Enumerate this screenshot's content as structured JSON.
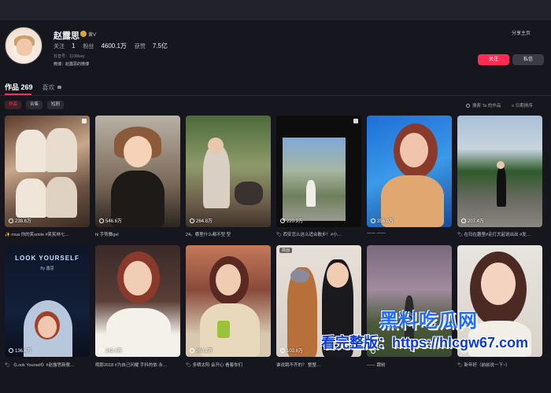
{
  "profile": {
    "name": "赵露思",
    "verified_label": "黄V",
    "stats": [
      {
        "label": "关注",
        "value": "1"
      },
      {
        "label": "粉丝",
        "value": "4600.1万"
      },
      {
        "label": "获赞",
        "value": "7.5亿"
      }
    ],
    "account": "抖音号：1108lusy",
    "bio": "微博：赵露思的微博",
    "share_label": "分享主页",
    "follow_label": "关注",
    "message_label": "私信"
  },
  "tabs": {
    "works": "作品 269",
    "likes": "喜欢"
  },
  "filters": [
    "作品",
    "合集",
    "短剧"
  ],
  "toolbar": {
    "search_placeholder": "搜索 Ta 的作品",
    "sort_label": "日期排序"
  },
  "videos": [
    {
      "plays": "238.6万",
      "caption": "✨ mua 你的笑smile #笑笑林七…",
      "pinned": true,
      "tag": ""
    },
    {
      "plays": "546.6万",
      "caption": "hi 手势舞gel",
      "pinned": false,
      "tag": ""
    },
    {
      "plays": "264.8万",
      "caption": "24。哪里什么都不型 型",
      "pinned": false,
      "tag": ""
    },
    {
      "plays": "220.9万",
      "caption": "🏷 西安怎么这么适合散步！#小…",
      "pinned": true,
      "tag": ""
    },
    {
      "plays": "356.0万",
      "caption": "—— ——",
      "pinned": false,
      "tag": ""
    },
    {
      "plays": "207.4万",
      "caption": "🏷 在玛在趣里#走打犬起说出出 #发…",
      "pinned": false,
      "tag": ""
    },
    {
      "plays": "136.4万",
      "caption": "🏷 《Look Yourself》#赵露思新歌…",
      "pinned": false,
      "tag": "",
      "overlay_title": "LOOK YOURSELF",
      "overlay_sub": "By 露思"
    },
    {
      "plays": "242.4万",
      "caption": "哦那2018 #为自己问耀 手抖的依 永…",
      "pinned": false,
      "tag": ""
    },
    {
      "plays": "260.2万",
      "caption": "🏷 多晒太阳 会开心 看着你们",
      "pinned": false,
      "tag": ""
    },
    {
      "plays": "103.6万",
      "caption": "谁说跳不齐的？ 整整…",
      "pinned": false,
      "tag": "共创"
    },
    {
      "plays": "",
      "caption": "—— 跟树",
      "pinned": false,
      "tag": ""
    },
    {
      "plays": "",
      "caption": "🏷 新年好（前前说一下~）",
      "pinned": false,
      "tag": ""
    }
  ],
  "watermark": {
    "line1": "黑料吃瓜网",
    "line2": "看完整版：https://hlcgw67.com"
  },
  "colors": {
    "accent": "#fe2c55",
    "background": "#16161e",
    "watermark": "#1f6bff"
  },
  "icons": [
    "heart-icon",
    "pin-icon",
    "lock-icon",
    "search-icon",
    "verified-icon",
    "sort-icon"
  ]
}
